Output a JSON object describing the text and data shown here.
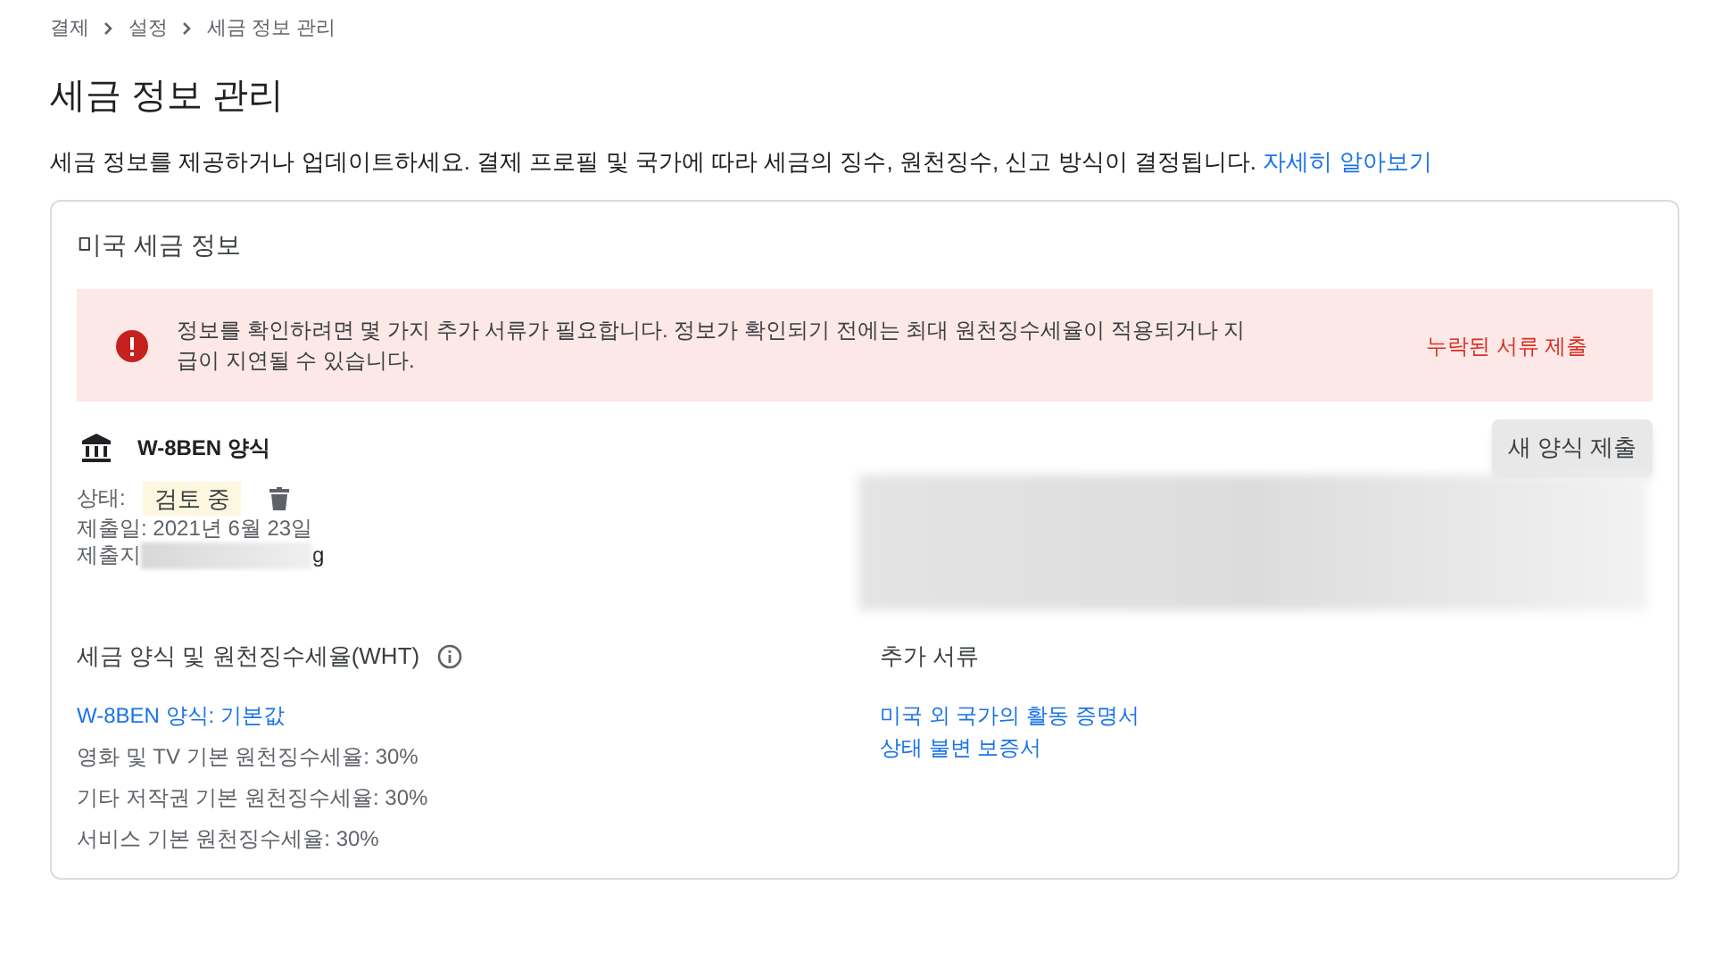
{
  "breadcrumb": [
    "결제",
    "설정",
    "세금 정보 관리"
  ],
  "title": "세금 정보 관리",
  "description": {
    "text": "세금 정보를 제공하거나 업데이트하세요. 결제 프로필 및 국가에 따라 세금의 징수, 원천징수, 신고 방식이 결정됩니다.",
    "link": "자세히 알아보기"
  },
  "card": {
    "title": "미국 세금 정보",
    "alert": {
      "message": "정보를 확인하려면 몇 가지 추가 서류가 필요합니다. 정보가 확인되기 전에는 최대 원천징수세율이 적용되거나 지급이 지연될 수 있습니다.",
      "action": "누락된 서류 제출"
    },
    "form": {
      "name": "W-8BEN 양식",
      "button": "새 양식 제출",
      "status_label": "상태:",
      "status": "검토 중",
      "submitted_date": "제출일: 2021년 6월 23일",
      "submitter_label": "제출지",
      "submitter_tail": "g"
    },
    "rates": {
      "heading": "세금 양식 및 원천징수세율(WHT)",
      "link": "W-8BEN 양식: 기본값",
      "items": [
        "영화 및 TV 기본 원천징수세율: 30%",
        "기타 저작권 기본 원천징수세율: 30%",
        "서비스 기본 원천징수세율: 30%"
      ]
    },
    "documents": {
      "heading": "추가 서류",
      "links": [
        "미국 외 국가의 활동 증명서",
        "상태 불변 보증서"
      ]
    }
  }
}
